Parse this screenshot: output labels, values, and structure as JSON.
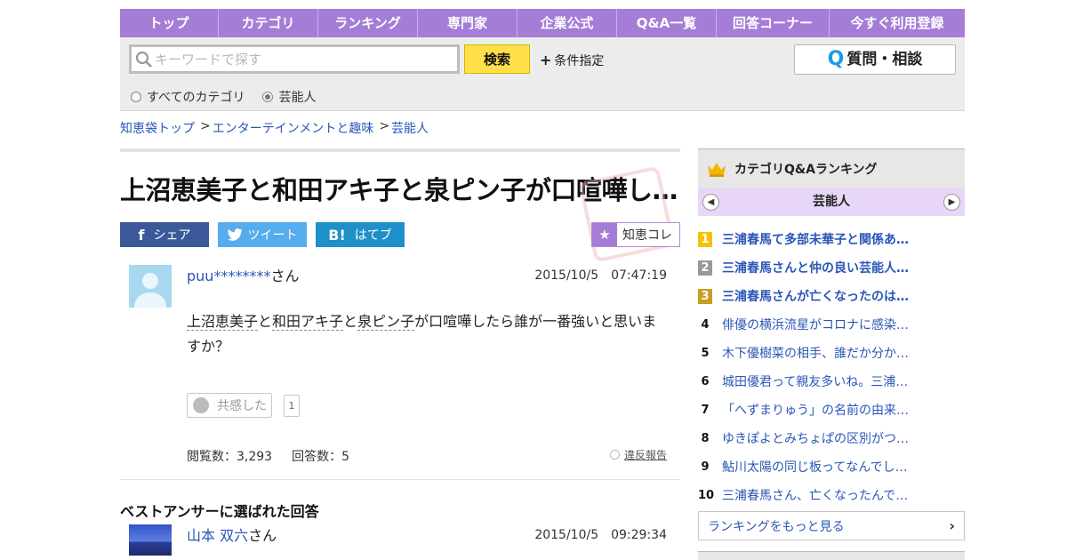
{
  "nav": [
    "トップ",
    "カテゴリ",
    "ランキング",
    "専門家",
    "企業公式",
    "Q&A一覧",
    "回答コーナー",
    "今すぐ利用登録"
  ],
  "search": {
    "placeholder": "キーワードで探す",
    "button": "検索",
    "condition": "条件指定",
    "ask_q": "Q",
    "ask": "質問・相談",
    "radio_all": "すべてのカテゴリ",
    "radio_cat": "芸能人"
  },
  "breadcrumb": [
    "知恵袋トップ",
    "エンターテインメントと趣味",
    "芸能人"
  ],
  "breadcrumb_sep": ">",
  "question": {
    "title": "上沼恵美子と和田アキ子と泉ピン子が口喧嘩し…",
    "share_fb": "シェア",
    "share_tw": "ツイート",
    "share_hb": "はてブ",
    "chie": "知恵コレ",
    "username": "puu********",
    "san": "さん",
    "time": "2015/10/5　07:47:19",
    "kw1": "上沼恵美子",
    "and1": "と",
    "kw2": "和田アキ子",
    "and2": "と",
    "kw3": "泉ピン子",
    "rest": "が口喧嘩したら誰が一番強いと思いますか？",
    "empathy": "共感した",
    "empathy_count": "1",
    "views": "閲覧数：3,293",
    "answers": "回答数：5",
    "report": "違反報告"
  },
  "best": {
    "heading": "ベストアンサーに選ばれた回答",
    "username": "山本 双六",
    "san": "さん",
    "time": "2015/10/5　09:29:34"
  },
  "sidebar": {
    "heading": "カテゴリQ&Aランキング",
    "category": "芸能人",
    "ranking": [
      {
        "n": "1",
        "title": "三浦春馬て多部未華子と関係あ…"
      },
      {
        "n": "2",
        "title": "三浦春馬さんと仲の良い芸能人…"
      },
      {
        "n": "3",
        "title": "三浦春馬さんが亡くなったのは…"
      },
      {
        "n": "4",
        "title": "俳優の横浜流星がコロナに感染…"
      },
      {
        "n": "5",
        "title": "木下優樹菜の相手、誰だか分か…"
      },
      {
        "n": "6",
        "title": "城田優君って親友多いね。三浦…"
      },
      {
        "n": "7",
        "title": "「へずまりゅう」の名前の由来…"
      },
      {
        "n": "8",
        "title": "ゆきぽよとみちょぱの区別がつ…"
      },
      {
        "n": "9",
        "title": "鮎川太陽の同じ板ってなんでし…"
      },
      {
        "n": "10",
        "title": "三浦春馬さん、亡くなったんで…"
      }
    ],
    "more": "ランキングをもっと見る"
  },
  "colors": {
    "accent": "#a57dd6",
    "link": "#2a56b8",
    "search_button": "#ffe04a"
  }
}
